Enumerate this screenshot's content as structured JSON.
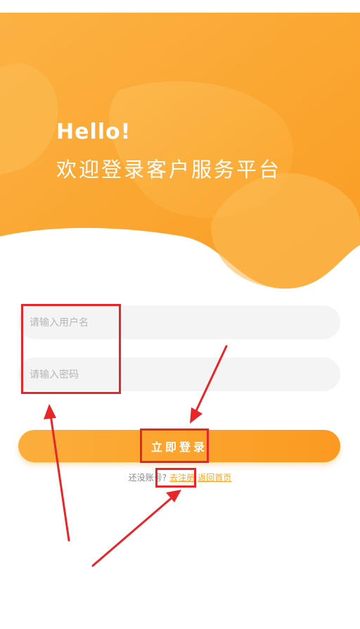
{
  "hero": {
    "title": "Hello!",
    "subtitle": "欢迎登录客户服务平台"
  },
  "form": {
    "username_placeholder": "请输入用户名",
    "password_placeholder": "请输入密码",
    "login_label": "立即登录"
  },
  "footer": {
    "prompt": "还没账号?",
    "register_link": "去注册",
    "home_link": "返回首页"
  },
  "colors": {
    "brand_orange": "#fb9a20",
    "annotation_red": "#e8262a",
    "link_orange": "#f5a623"
  }
}
